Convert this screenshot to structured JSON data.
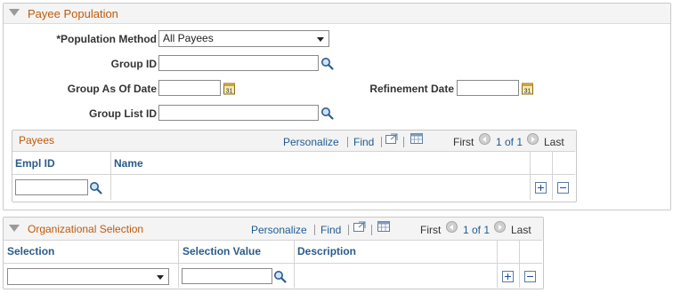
{
  "payee_population": {
    "title": "Payee Population",
    "population_method_label": "*Population Method",
    "population_method_value": "All Payees",
    "group_id_label": "Group ID",
    "group_id_value": "",
    "group_as_of_date_label": "Group As Of Date",
    "group_as_of_date_value": "",
    "refinement_date_label": "Refinement Date",
    "refinement_date_value": "",
    "group_list_id_label": "Group List ID",
    "group_list_id_value": ""
  },
  "payees_grid": {
    "title": "Payees",
    "personalize": "Personalize",
    "find": "Find",
    "first": "First",
    "range": "1 of 1",
    "last": "Last",
    "columns": [
      "Empl ID",
      "Name"
    ],
    "rows": [
      {
        "empl_id": "",
        "name": ""
      }
    ]
  },
  "org_selection": {
    "title": "Organizational Selection",
    "personalize": "Personalize",
    "find": "Find",
    "first": "First",
    "range": "1 of 1",
    "last": "Last",
    "columns": [
      "Selection",
      "Selection Value",
      "Description"
    ],
    "rows": [
      {
        "selection": "",
        "selection_value": "",
        "description": ""
      }
    ]
  },
  "icons": {
    "lookup": "magnifier-icon",
    "calendar": "calendar-icon",
    "add": "plus-icon",
    "delete": "minus-icon"
  },
  "colors": {
    "section_title": "#c05a0a",
    "link": "#1f5b94",
    "grid_header": "#2b5b8a"
  }
}
